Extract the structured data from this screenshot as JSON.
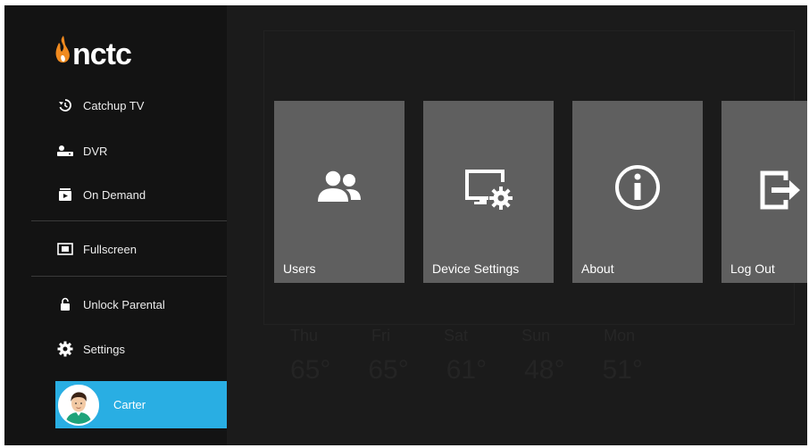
{
  "app": {
    "logo_text": "nctc"
  },
  "sidebar": {
    "items": [
      {
        "label": "Catchup TV",
        "icon": "history-icon"
      },
      {
        "label": "DVR",
        "icon": "dvr-icon"
      },
      {
        "label": "On Demand",
        "icon": "on-demand-icon"
      },
      {
        "label": "Fullscreen",
        "icon": "fullscreen-icon"
      },
      {
        "label": "Unlock Parental",
        "icon": "lock-icon"
      },
      {
        "label": "Settings",
        "icon": "gear-icon"
      }
    ],
    "user": {
      "name": "Carter",
      "highlight_color": "#29aee3"
    }
  },
  "settings_tiles": [
    {
      "label": "Users",
      "icon": "users-icon"
    },
    {
      "label": "Device Settings",
      "icon": "device-settings-icon"
    },
    {
      "label": "About",
      "icon": "info-icon"
    },
    {
      "label": "Log Out",
      "icon": "logout-icon"
    }
  ]
}
